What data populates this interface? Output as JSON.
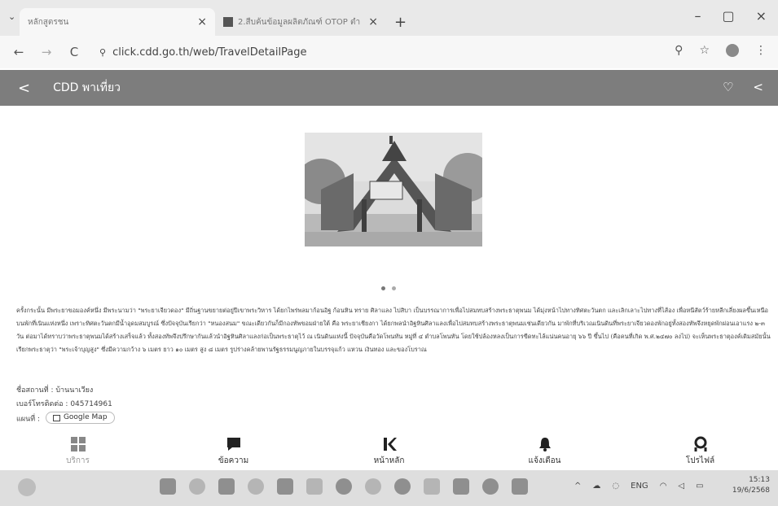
{
  "browser": {
    "tabs": [
      {
        "label": "หลักสูตรชน",
        "close": "×"
      },
      {
        "label": "2.สืบค้นข้อมูลผลิตภัณฑ์ OTOP ตำ",
        "close": "×"
      }
    ],
    "new_tab": "+",
    "window_controls": {
      "minimize": "–",
      "maximize": "▢",
      "close": "×"
    },
    "url": "click.cdd.go.th/web/TravelDetailPage",
    "nav": {
      "back": "←",
      "forward": "→",
      "reload": "C"
    }
  },
  "app": {
    "header_title": "CDD พาเที่ยว",
    "back": "<",
    "favorite": "♡",
    "share": "<"
  },
  "gallery": {
    "dots": 2,
    "active": 0
  },
  "description": "ครั้งกระนั้น มีพระยาขอมองค์หนึ่ง มีพระนามว่า \"พระยาเจียวดอง\" มีถิ่นฐานขยายต่อยู่ปีเขาพระวิหาร ได้ยกไพร่พลมาก้อนอิฐ ก้อนหิน ทราย ศิลาแลง ไปสิบา เป็นบรรณาการเพื่อไปสมทบสร้างพระธาตุพนม ได้มุ่งหน้าไปทางทิศตะวันตก และเลิกเลาะไปทางที่ไส้อง เพื่อหนีสัตว์ร้ายหลีกเลี่ยงผลขึ้นเหนือบนพักที่เนินแห่งหนึ่ง เพราะทิศตะวันตกมีน้ำอุดมสมบูรณ์ ซึ่งปัจจุบันเรียกว่า \"หนองสนม\" ขณะเดียวกันก็มีกองทัพขอมฝ่ายใต้ คือ พระยาเชียงกา ได้ยกพลนำอิฐหินศิลาแลงเพื่อไปสมทบสร้างพระธาตุพนมเช่นเดียวกัน มาพักที่บริเวณเนินดินที่พระยาเจียวดองพักอยู่ทั้งสองทัพจึงหยุดพักผ่อนเอาแรง ๒-๓ วัน ต่อมาได้ทราบว่าพระธาตุพนมได้สร้างเสร็จแล้ว ทั้งสองทัพจึงปรึกษากันแล้วนำอิฐหินศิลาแลงก่อเป็นพระธาตุไว้ ณ เนินดินแห่งนี้ ปัจจุบันคือวัดโพนทัน หมู่ที่ ๔ ตำบลโพนทัน โดยใช้ปล้องหลงเป็นการขีดทะไล้แน่นคนอายุ ๖๖ ปี ขึ้นไป (คือคนที่เกิด พ.ศ.๒๔๗๐ ลงไป) จะเห็นพระธาตุองค์เดิมสมัยนั้นเรียกพระธาตุว่า \"พระเจ้าบุญสูง\" ซึ่งมีความกว้าง ๖ เมตร ยาว ๑๐ เมตร สูง ๘ เมตร รูปร่างคล้ายพานรัฐธรรมนูญภายในบรรจุแก้ว แหวน เงินทอง และของโบราณ",
  "info": {
    "place_label": "ชื่อสถานที่ : บ้านนาเวียง",
    "phone_label": "เบอร์โทรติดต่อ : 045714961",
    "map_label": "แผนที่ :",
    "map_button": "Google Map"
  },
  "bottom_nav": [
    {
      "label": "บริการ",
      "icon": "grid-icon"
    },
    {
      "label": "ข้อความ",
      "icon": "chat-icon"
    },
    {
      "label": "หน้าหลัก",
      "icon": "logo-icon"
    },
    {
      "label": "แจ้งเตือน",
      "icon": "bell-icon"
    },
    {
      "label": "โปรไฟล์",
      "icon": "user-icon"
    }
  ],
  "taskbar": {
    "tray": {
      "lang": "ENG",
      "chevron": "^"
    },
    "time": "15:13",
    "date": "19/6/2568"
  },
  "colors": {
    "header": "#7d7d7d",
    "tab_bar": "#e9e9e9",
    "taskbar": "#dedede"
  }
}
